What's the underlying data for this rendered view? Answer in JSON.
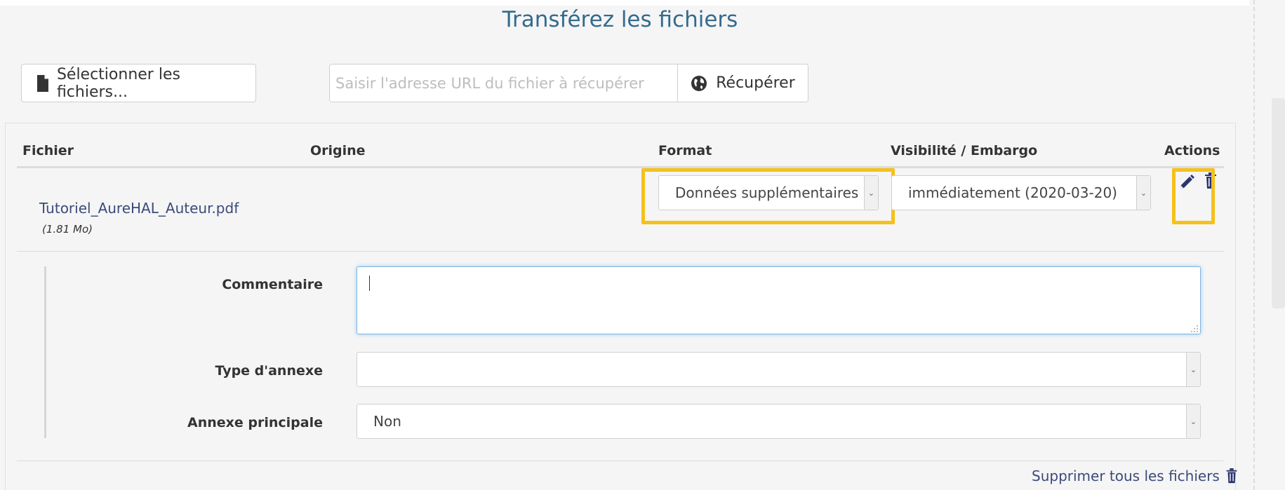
{
  "title": "Transférez les fichiers",
  "toolbar": {
    "select_files_label": "Sélectionner les fichiers...",
    "url_placeholder": "Saisir l'adresse URL du fichier à récupérer",
    "fetch_label": "Récupérer"
  },
  "table": {
    "headers": {
      "file": "Fichier",
      "origin": "Origine",
      "format": "Format",
      "visibility": "Visibilité / Embargo",
      "actions": "Actions"
    },
    "row": {
      "file_name": "Tutoriel_AureHAL_Auteur.pdf",
      "file_size": "(1.81 Mo)",
      "format_value": "Données supplémentaires",
      "visibility_value": "immédiatement (2020-03-20)"
    }
  },
  "details": {
    "comment_label": "Commentaire",
    "comment_value": "",
    "annex_type_label": "Type d'annexe",
    "annex_type_value": "",
    "main_annex_label": "Annexe principale",
    "main_annex_value": "Non"
  },
  "delete_all_label": "Supprimer tous les fichiers",
  "colors": {
    "highlight": "#f5c11b",
    "title": "#336b8d",
    "link": "#3c4a7a",
    "icon": "#2c3470"
  },
  "icons": [
    "file-icon",
    "globe-icon",
    "pencil-icon",
    "trash-icon"
  ]
}
